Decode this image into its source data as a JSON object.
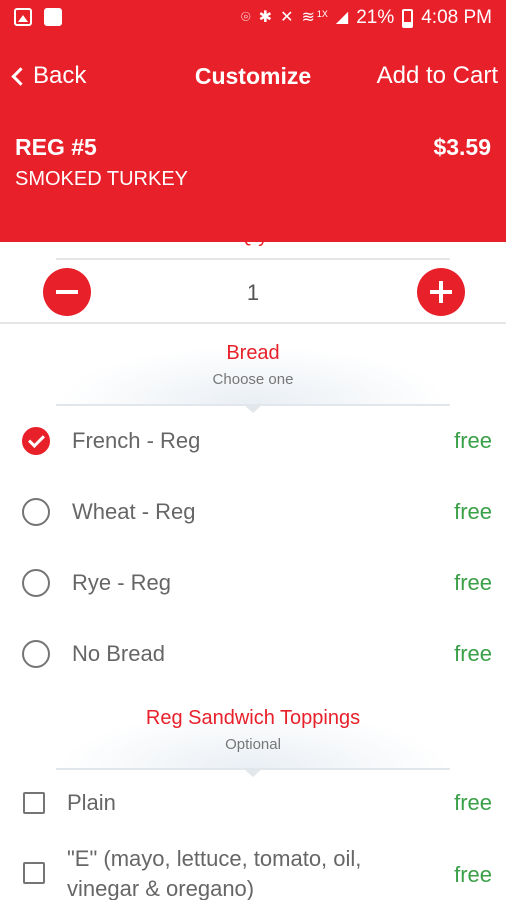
{
  "status_bar": {
    "left_icons": [
      "image-icon",
      "document-icon"
    ],
    "right_icons": [
      "location-icon",
      "bluetooth-icon",
      "mute-icon",
      "wifi-icon",
      "signal-icon",
      "battery-icon"
    ],
    "network_tag": "1X",
    "battery": "21%",
    "time": "4:08 PM"
  },
  "header": {
    "back_label": "Back",
    "title": "Customize",
    "add_to_cart_label": "Add to Cart",
    "item_code": "REG #5",
    "item_name": "SMOKED TURKEY",
    "item_price": "$3.59",
    "color": "#e8202a"
  },
  "quantity": {
    "label": "Qty",
    "value": "1"
  },
  "bread": {
    "title": "Bread",
    "subtitle": "Choose one",
    "options": [
      {
        "label": "French - Reg",
        "price": "free",
        "selected": true
      },
      {
        "label": "Wheat - Reg",
        "price": "free",
        "selected": false
      },
      {
        "label": "Rye - Reg",
        "price": "free",
        "selected": false
      },
      {
        "label": "No Bread",
        "price": "free",
        "selected": false
      }
    ]
  },
  "toppings": {
    "title": "Reg Sandwich Toppings",
    "subtitle": "Optional",
    "options": [
      {
        "label": "Plain",
        "price": "free",
        "checked": false
      },
      {
        "label": "\"E\" (mayo, lettuce, tomato, oil,",
        "label_line2": "vinegar & oregano)",
        "price": "free",
        "checked": false
      }
    ]
  },
  "colors": {
    "accent": "#e8202a",
    "price_free": "#3aa047"
  }
}
